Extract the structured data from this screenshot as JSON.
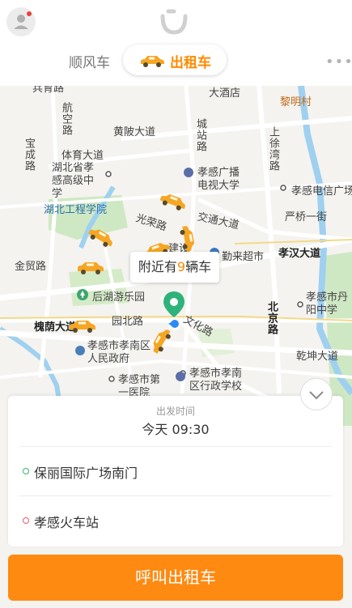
{
  "header": {
    "tabs": {
      "ride_share": "顺风车",
      "taxi": "出租车"
    },
    "avatar_icon": "user-icon",
    "logo_icon": "didi-logo-icon",
    "more_icon": "more-dots-icon"
  },
  "map": {
    "labels": {
      "top_cut": "兵育路",
      "hangkong": "航空路",
      "huangpi": "黄陂大道",
      "chengzhan": "城站路",
      "shangxu": "上徐湾路",
      "hotel": "大酒店",
      "liming": "黎明村",
      "baocheng": "宝成路",
      "tiyu": "体育大道",
      "school": "湖北省孝感高级中学",
      "tv_univ": "孝感广播电视大学",
      "telecom": "孝感电信广场",
      "institute": "湖北工程学院",
      "yanqiao": "严桥一街",
      "jiaotong": "交通大道",
      "guangrong": "光荣路",
      "jianshe": "建设",
      "qinlai": "勤来超市",
      "xiaohan": "孝汉大道",
      "jinmao": "金贸路",
      "park": "后湖游乐园",
      "danyang": "孝感市丹阳中学",
      "beijing": "北京路",
      "yuanbei": "园北路",
      "huaiyin": "槐荫大道",
      "wenhua": "文化路",
      "gov": "孝感市孝南区人民政府",
      "qiantan": "乾坤大道",
      "hospital": "孝感市第一医院",
      "admin_school": "孝感市孝南区行政学校"
    },
    "nearby_prefix": "附近有",
    "nearby_count": "9",
    "nearby_suffix": "辆车",
    "location_pin_icon": "location-pin-icon",
    "my_location_icon": "my-location-icon",
    "taxi_icon": "taxi-car-icon"
  },
  "trip": {
    "departure_label": "出发时间",
    "departure_time": "今天 09:30",
    "pickup": "保丽国际广场南门",
    "destination": "孝感火车站",
    "pickup_dot_color": "#3cb371",
    "destination_dot_color": "#e85a6a",
    "collapse_icon": "chevron-down-icon"
  },
  "call_button": "呼叫出租车",
  "colors": {
    "accent": "#ff8a00",
    "button": "#ff8a12",
    "river": "#9fd0f0"
  }
}
